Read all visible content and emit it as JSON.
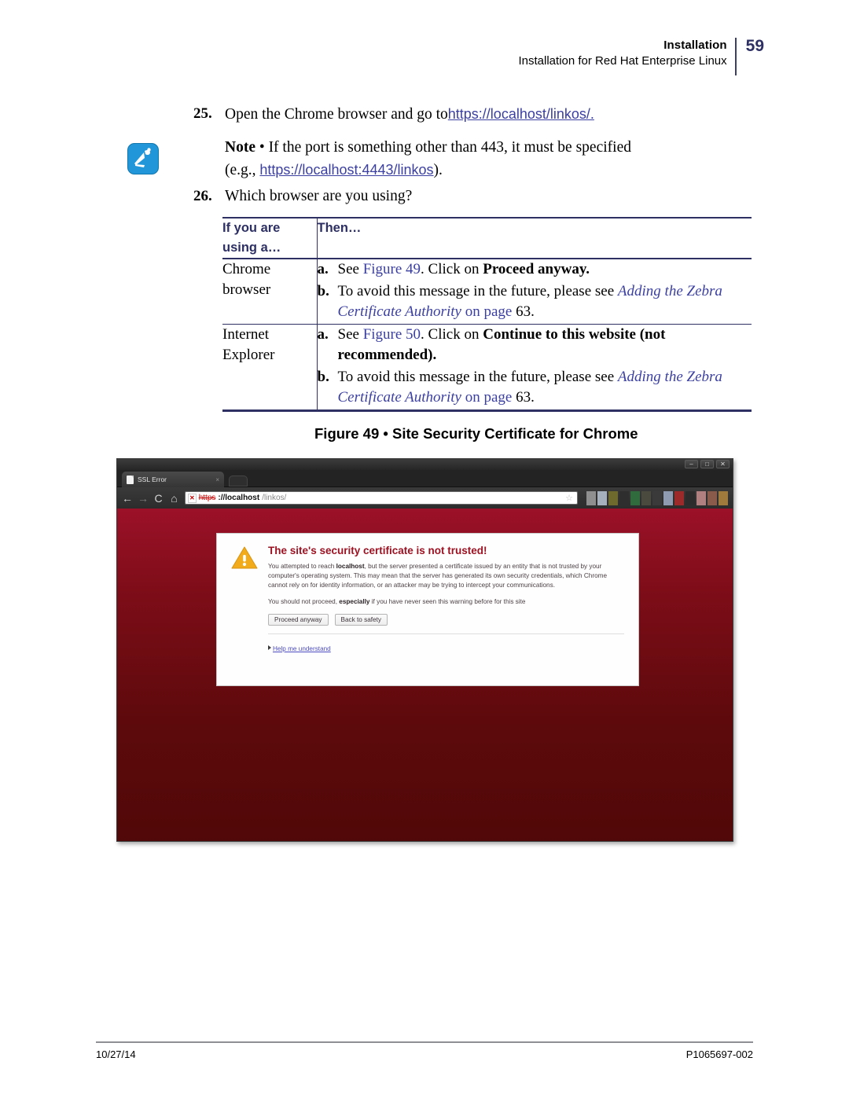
{
  "header": {
    "title": "Installation",
    "subtitle": "Installation for Red Hat Enterprise Linux",
    "page_number": "59"
  },
  "steps": [
    {
      "number": "25.",
      "text_before": "Open the Chrome browser and go to",
      "link": "https://localhost/linkos/."
    },
    {
      "number": "26.",
      "text": "Which browser are you using?"
    }
  ],
  "note": {
    "label": "Note",
    "separator": "•",
    "line1": "If the port is something other than 443, it must be specified",
    "prefix2": "(e.g., ",
    "link": "https://localhost:4443/linkos",
    "suffix2": ")."
  },
  "table": {
    "headers": {
      "col1_line1": "If you are",
      "col1_line2": "using a…",
      "col2": "Then…"
    },
    "rows": [
      {
        "browser_line1": "Chrome",
        "browser_line2": "browser",
        "items": [
          {
            "mark": "a.",
            "pre": "See ",
            "figure": "Figure 49",
            "mid": ". Click on ",
            "bold": "Proceed anyway.",
            "post": ""
          },
          {
            "mark": "b.",
            "pre": "To avoid this message in the future, please see ",
            "italic_link": "Adding the Zebra Certificate Authority",
            "mid": " on page ",
            "page": "63",
            "post": "."
          }
        ]
      },
      {
        "browser_line1": "Internet",
        "browser_line2": "Explorer",
        "items": [
          {
            "mark": "a.",
            "pre": "See ",
            "figure": "Figure 50",
            "mid": ". Click on ",
            "bold": "Continue to this website (not recommended).",
            "post": ""
          },
          {
            "mark": "b.",
            "pre": "To avoid this message in the future, please see ",
            "italic_link": "Adding the Zebra Certificate Authority",
            "mid": " on page ",
            "page": "63",
            "post": "."
          }
        ]
      }
    ]
  },
  "figure": {
    "caption": "Figure 49 • Site Security Certificate for Chrome"
  },
  "browser": {
    "window_controls": {
      "minimize": "–",
      "maximize": "□",
      "close": "✕"
    },
    "tab": {
      "title": "SSL Error",
      "close": "×"
    },
    "toolbar": {
      "back": "←",
      "forward": "→",
      "reload": "C",
      "home": "⌂",
      "star": "☆"
    },
    "omnibox": {
      "badge": "✕",
      "scheme": "https",
      "host": "://localhost",
      "path": "/linkos/"
    },
    "bookmark_colors": [
      "#8f8f8f",
      "#a6b0bd",
      "#6e6a2e",
      "#2e2e2e",
      "#2f6b3c",
      "#4a4a3e",
      "#3a3a3a",
      "#8f9bb0",
      "#9c2a2a",
      "#2c2c2c",
      "#b08080",
      "#8a5a4a",
      "#a07a3c"
    ],
    "ssl_page": {
      "title": "The site's security certificate is not trusted!",
      "para1_a": "You attempted to reach ",
      "para1_bold": "localhost",
      "para1_b": ", but the server presented a certificate issued by an entity that is not trusted by your computer's operating system. This may mean that the server has generated its own security credentials, which Chrome cannot rely on for identity information, or an attacker may be trying to intercept your communications.",
      "para2_a": "You should not proceed, ",
      "para2_bold": "especially",
      "para2_b": " if you have never seen this warning before for this site",
      "button_proceed": "Proceed anyway",
      "button_back": "Back to safety",
      "help_link": "Help me understand"
    }
  },
  "footer": {
    "date": "10/27/14",
    "part_number": "P1065697-002"
  },
  "colors": {
    "accent_navy": "#2e3064",
    "link_blue": "#3b3fa0",
    "warning_red": "#9d1222",
    "zebra_blue": "#2196d8"
  }
}
